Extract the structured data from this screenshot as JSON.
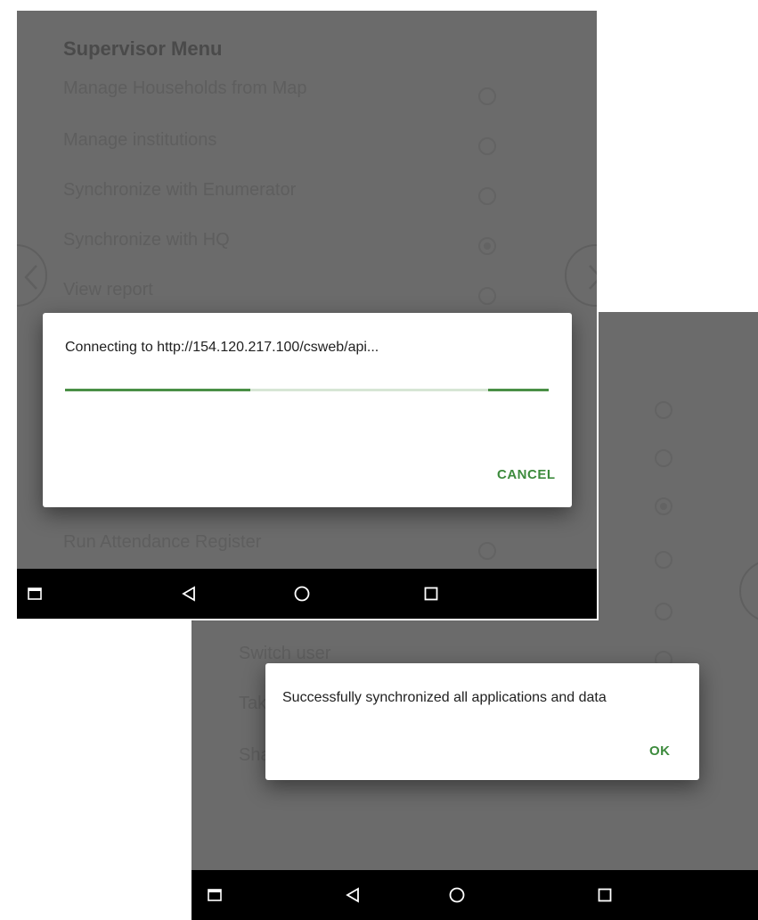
{
  "back_screen": {
    "menu_items": [
      {
        "label": "Run Attendance Register"
      },
      {
        "label": "Switch user"
      },
      {
        "label": "Take"
      },
      {
        "label": "Sha"
      }
    ],
    "dialog": {
      "message": "Successfully synchronized all applications and data",
      "ok_label": "OK"
    }
  },
  "front_screen": {
    "menu_title": "Supervisor Menu",
    "menu_items": [
      {
        "label": "Manage Households from Map",
        "selected": false
      },
      {
        "label": "Manage institutions",
        "selected": false
      },
      {
        "label": "Synchronize with Enumerator",
        "selected": false
      },
      {
        "label": "Synchronize with HQ",
        "selected": true
      },
      {
        "label": "View report",
        "selected": false
      },
      {
        "label": "Run Attendance Register",
        "selected": false
      }
    ],
    "dialog": {
      "message": "Connecting to http://154.120.217.100/csweb/api...",
      "cancel_label": "CANCEL"
    }
  },
  "colors": {
    "dim_overlay": "#6b6b6b",
    "accent_green": "#3d8b3d",
    "progress_green": "#4a8f46",
    "progress_track": "#d7e6d5",
    "navbar": "#000000"
  },
  "icons": {
    "nav_bar": [
      "window-icon",
      "back-triangle-icon",
      "home-circle-icon",
      "recents-square-icon"
    ],
    "carousel": [
      "chevron-left-icon",
      "chevron-right-icon"
    ]
  }
}
